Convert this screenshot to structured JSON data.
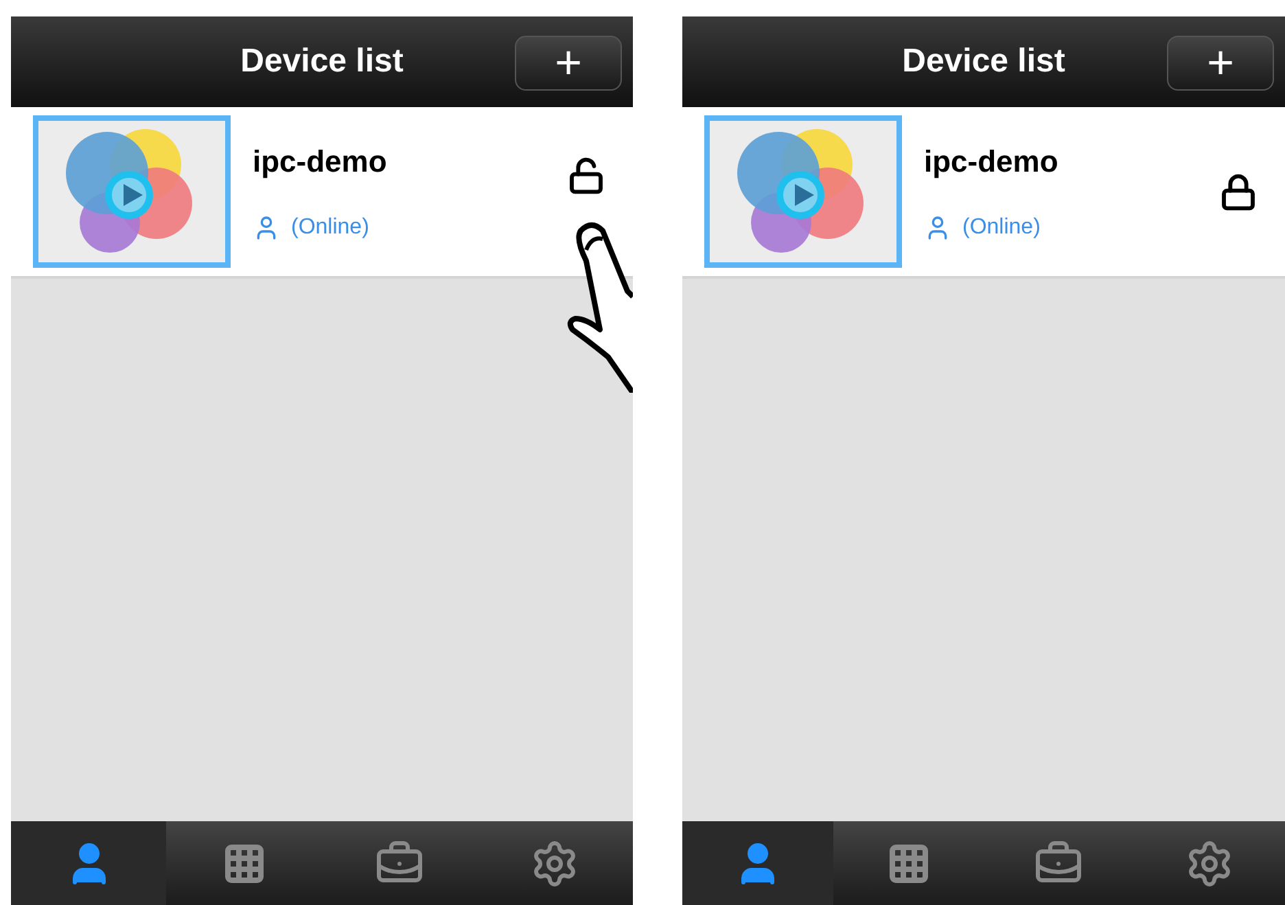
{
  "screens": [
    {
      "title": "Device list",
      "add_button": "+",
      "tap_hint": true,
      "devices": [
        {
          "name": "ipc-demo",
          "status": "(Online)",
          "locked": false
        }
      ],
      "tabs": [
        {
          "kind": "person",
          "selected": true
        },
        {
          "kind": "grid",
          "selected": false
        },
        {
          "kind": "toolbox",
          "selected": false
        },
        {
          "kind": "gear",
          "selected": false
        }
      ]
    },
    {
      "title": "Device list",
      "add_button": "+",
      "tap_hint": false,
      "devices": [
        {
          "name": "ipc-demo",
          "status": "(Online)",
          "locked": true
        }
      ],
      "tabs": [
        {
          "kind": "person",
          "selected": true
        },
        {
          "kind": "grid",
          "selected": false
        },
        {
          "kind": "toolbox",
          "selected": false
        },
        {
          "kind": "gear",
          "selected": false
        }
      ]
    }
  ]
}
